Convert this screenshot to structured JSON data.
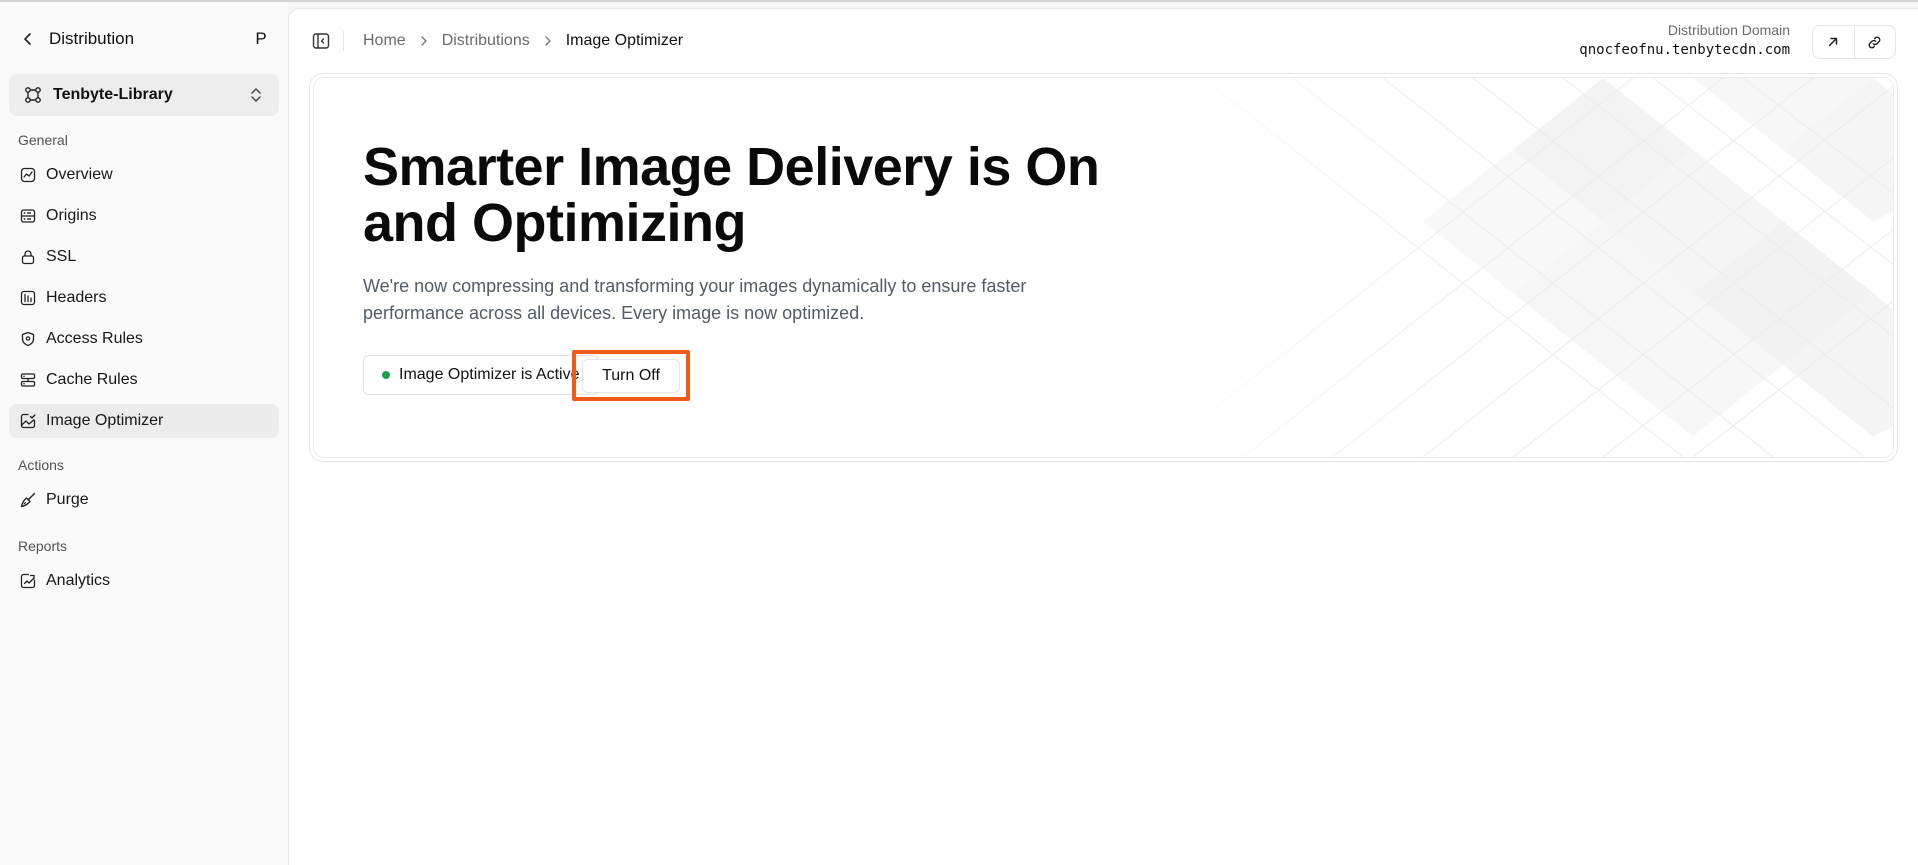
{
  "sidebar": {
    "title": "Distribution",
    "avatar_initial": "P",
    "project": "Tenbyte-Library",
    "groups": {
      "general": "General",
      "actions": "Actions",
      "reports": "Reports"
    },
    "items": [
      {
        "label": "Overview",
        "icon": "chart-line-icon"
      },
      {
        "label": "Origins",
        "icon": "server-icon"
      },
      {
        "label": "SSL",
        "icon": "lock-icon"
      },
      {
        "label": "Headers",
        "icon": "headers-icon"
      },
      {
        "label": "Access Rules",
        "icon": "shield-icon"
      },
      {
        "label": "Cache Rules",
        "icon": "database-icon"
      },
      {
        "label": "Image Optimizer",
        "icon": "image-check-icon",
        "active": true
      },
      {
        "label": "Purge",
        "icon": "broom-icon"
      },
      {
        "label": "Analytics",
        "icon": "analytics-icon"
      }
    ]
  },
  "breadcrumb": {
    "home": "Home",
    "distributions": "Distributions",
    "current": "Image Optimizer"
  },
  "domain": {
    "label": "Distribution Domain",
    "value": "qnocfeofnu.tenbytecdn.com"
  },
  "hero": {
    "title": "Smarter Image Delivery is On and Optimizing",
    "description": "We're now compressing and transforming your images dynamically to ensure faster performance across all devices. Every image is now optimized.",
    "status": "Image Optimizer is Active",
    "turn_off_label": "Turn Off"
  },
  "colors": {
    "status_active": "#16a34a",
    "highlight": "#f15a1a"
  }
}
